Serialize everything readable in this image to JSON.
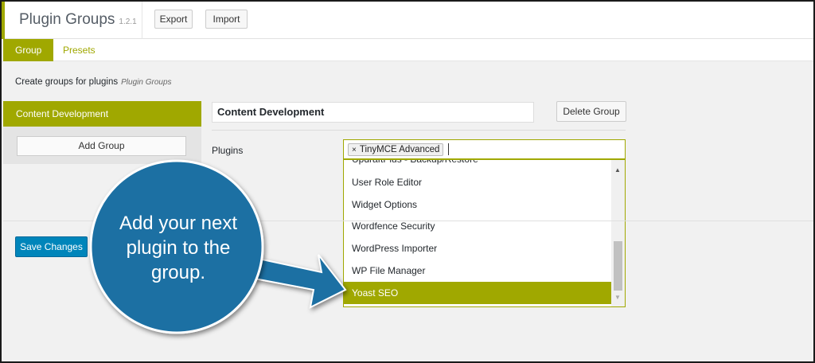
{
  "header": {
    "title": "Plugin Groups",
    "version": "1.2.1",
    "export_label": "Export",
    "import_label": "Import"
  },
  "tabs": [
    {
      "label": "Group",
      "active": true
    },
    {
      "label": "Presets",
      "active": false
    }
  ],
  "description": {
    "text": "Create groups for plugins",
    "sub": "Plugin Groups"
  },
  "sidebar": {
    "active_group": "Content Development",
    "add_group_label": "Add Group"
  },
  "group": {
    "name": "Content Development",
    "delete_label": "Delete Group",
    "plugins_label": "Plugins",
    "selected_tags": [
      "TinyMCE Advanced"
    ],
    "options": [
      {
        "label": "UpdraftPlus - Backup/Restore",
        "selected": false
      },
      {
        "label": "User Role Editor",
        "selected": false
      },
      {
        "label": "Widget Options",
        "selected": false
      },
      {
        "label": "Wordfence Security",
        "selected": false
      },
      {
        "label": "WordPress Importer",
        "selected": false
      },
      {
        "label": "WP File Manager",
        "selected": false
      },
      {
        "label": "Yoast SEO",
        "selected": true
      }
    ]
  },
  "save_label": "Save Changes",
  "callout": {
    "text": "Add your next plugin to the group.",
    "color": "#1a6fa3"
  },
  "colors": {
    "accent": "#a0a800",
    "primary_button": "#0085ba"
  }
}
